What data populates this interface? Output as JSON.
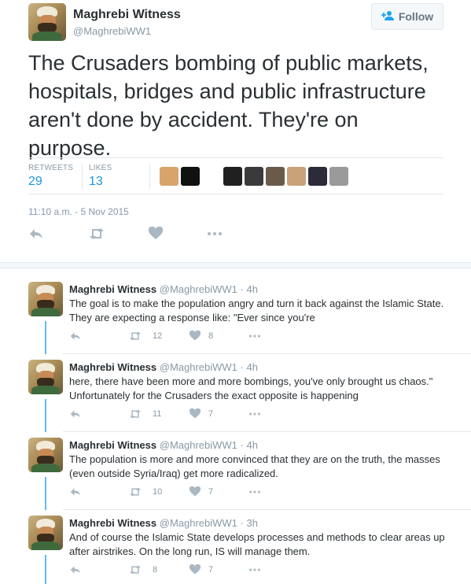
{
  "author": {
    "name": "Maghrebi Witness",
    "handle": "@MaghrebiWW1"
  },
  "follow_button": {
    "label": "Follow",
    "icon": "add-user-icon"
  },
  "tweet": {
    "text": "The Crusaders bombing of public markets, hospitals, bridges and public infrastructure aren't done by accident. They're on purpose.",
    "retweets_label": "RETWEETS",
    "retweets_count": "29",
    "likes_label": "LIKES",
    "likes_count": "13",
    "timestamp": "11:10 a.m. - 5 Nov 2015"
  },
  "liker_avatars": [
    {
      "name": "liker-avatar-1",
      "color": "#d9a36c"
    },
    {
      "name": "liker-avatar-2",
      "color": "#111111"
    },
    {
      "name": "liker-avatar-3",
      "color": "#202020"
    },
    {
      "name": "liker-avatar-4",
      "color": "#3a3a3a"
    },
    {
      "name": "liker-avatar-5",
      "color": "#6b5a4a"
    },
    {
      "name": "liker-avatar-6",
      "color": "#c9a27a"
    },
    {
      "name": "liker-avatar-7",
      "color": "#2b2b3a"
    },
    {
      "name": "liker-avatar-8",
      "color": "#9a9a9a"
    }
  ],
  "icons": {
    "reply": "reply-icon",
    "retweet": "retweet-icon",
    "like": "heart-icon",
    "more": "more-icon"
  },
  "colors": {
    "link_blue": "#1b95e0",
    "thread_line": "#1da1f2",
    "muted": "#8899a6"
  },
  "replies": [
    {
      "name": "Maghrebi Witness",
      "handle_time": "@MaghrebiWW1 · 4h",
      "text": "The goal is to make the population angry and turn it back against the Islamic State. They are expecting a response like: \"Ever since you're",
      "retweets": "12",
      "likes": "8"
    },
    {
      "name": "Maghrebi Witness",
      "handle_time": "@MaghrebiWW1 · 4h",
      "text": "here, there have been more and more bombings, you've only brought us chaos.\" Unfortunately for the Crusaders the exact opposite is happening",
      "retweets": "11",
      "likes": "7"
    },
    {
      "name": "Maghrebi Witness",
      "handle_time": "@MaghrebiWW1 · 4h",
      "text": "The population is more and more convinced that they are on the truth, the masses (even outside Syria/Iraq) get more radicalized.",
      "retweets": "10",
      "likes": "7"
    },
    {
      "name": "Maghrebi Witness",
      "handle_time": "@MaghrebiWW1 · 3h",
      "text": "And of course the Islamic State develops processes and methods to clear areas up after airstrikes. On the long run, IS will manage them.",
      "retweets": "8",
      "likes": "7"
    }
  ]
}
